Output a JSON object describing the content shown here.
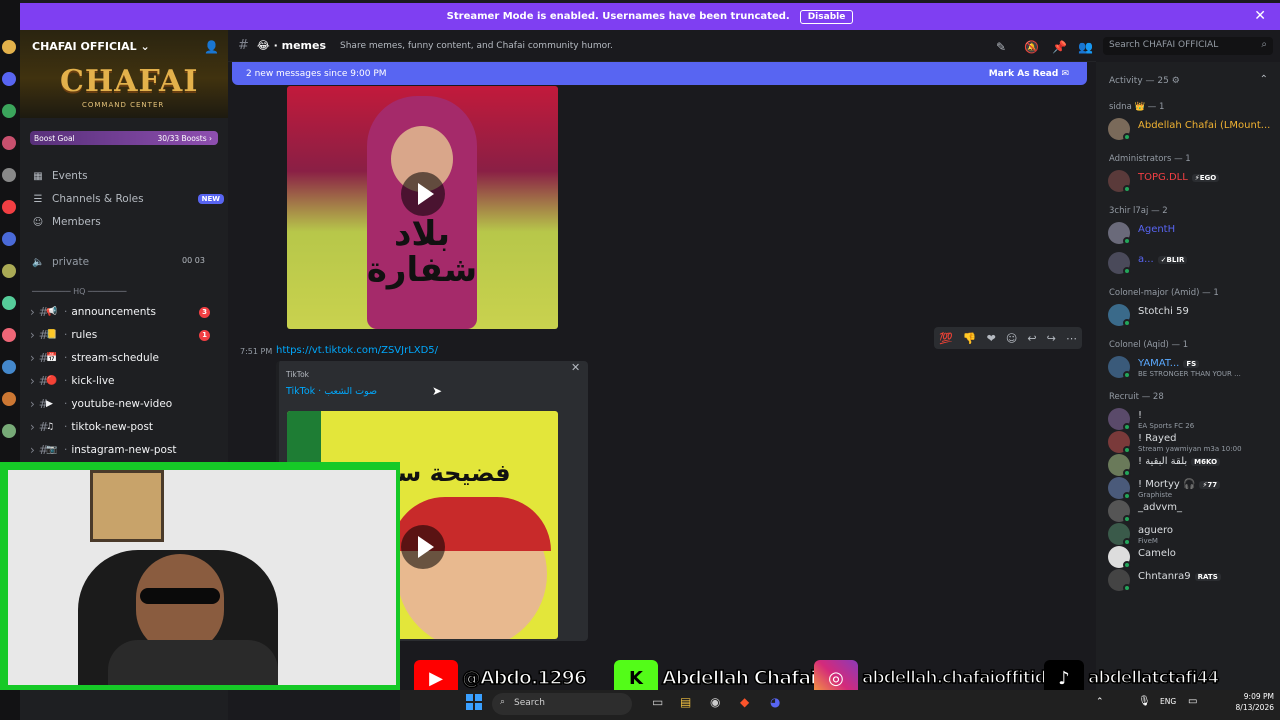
{
  "banner": {
    "text": "Streamer Mode is enabled. Usernames have been truncated.",
    "disable_label": "Disable",
    "close": "✕"
  },
  "server": {
    "name": "CHAFAI OFFICIAL",
    "logo_text": "CHAFAI",
    "logo_subtext": "COMMAND CENTER",
    "boost_label": "Boost Goal",
    "boost_progress": "30/33 Boosts",
    "boost_fraction": 0.909
  },
  "nav": {
    "events": "Events",
    "channels_roles": "Channels & Roles",
    "new_badge": "NEW",
    "members": "Members",
    "private": "private",
    "private_counts": "00 03"
  },
  "category": "HQ",
  "channels": [
    {
      "name": "announcements",
      "emoji": "📢",
      "badge": "3"
    },
    {
      "name": "rules",
      "emoji": "📒",
      "badge": "1"
    },
    {
      "name": "stream-schedule",
      "emoji": "📅",
      "badge": ""
    },
    {
      "name": "kick-live",
      "emoji": "🔴",
      "badge": ""
    },
    {
      "name": "youtube-new-video",
      "emoji": "▶",
      "badge": ""
    },
    {
      "name": "tiktok-new-post",
      "emoji": "♫",
      "badge": ""
    },
    {
      "name": "instagram-new-post",
      "emoji": "📷",
      "badge": ""
    }
  ],
  "header": {
    "channel_name": "memes",
    "topic": "Share memes, funny content, and Chafai community humor.",
    "search_placeholder": "Search CHAFAI OFFICIAL"
  },
  "new_messages": {
    "text": "2 new messages since 9:00 PM",
    "mark_read": "Mark As Read"
  },
  "message": {
    "time": "7:51 PM",
    "link": "https://vt.tiktok.com/ZSVJrLXD5/",
    "embed_provider": "TikTok",
    "embed_title": "TikTok · صوت الشعب",
    "video1_caption": "بلاد شفارة",
    "video2_caption": "فضيحة سي"
  },
  "members_panel": {
    "activity": "Activity — 25",
    "groups": [
      {
        "header": "sidna 👑 — 1",
        "members": [
          {
            "name": "Abdellah Chafai (LMount...",
            "sub": "",
            "tag": "",
            "color": "#f0b232"
          }
        ]
      },
      {
        "header": "Administrators — 1",
        "members": [
          {
            "name": "TOPG.DLL",
            "sub": "",
            "tag": "⚡EGO",
            "color": "#f23f43"
          }
        ]
      },
      {
        "header": "3chir l7aj — 2",
        "members": [
          {
            "name": "AgentH",
            "sub": "",
            "tag": "",
            "color": "#5865f2"
          },
          {
            "name": "a...",
            "sub": "",
            "tag": "✓BLIR",
            "color": "#5865f2"
          }
        ]
      },
      {
        "header": "Colonel-major (Amid) — 1",
        "members": [
          {
            "name": "Stotchi 59",
            "sub": "",
            "tag": "",
            "color": "#dbdee1"
          }
        ]
      },
      {
        "header": "Colonel (Aqid) — 1",
        "members": [
          {
            "name": "YAMAT...",
            "sub": "BE STRONGER THAN YOUR ...",
            "tag": "FS",
            "color": "#5aa9ff"
          }
        ]
      },
      {
        "header": "Recruit — 28",
        "members": [
          {
            "name": "!",
            "sub": "EA Sports FC 26",
            "tag": "",
            "color": "#dbdee1"
          },
          {
            "name": "! Rayed",
            "sub": "Stream yawmiyan m3a 10:00",
            "tag": "",
            "color": "#dbdee1"
          },
          {
            "name": "! بلقة البقية",
            "sub": "",
            "tag": "M6KO",
            "color": "#dbdee1"
          },
          {
            "name": "! Mortyy 🎧",
            "sub": "Graphiste",
            "tag": "⚡77",
            "color": "#dbdee1"
          },
          {
            "name": "_advvm_",
            "sub": "",
            "tag": "",
            "color": "#dbdee1"
          },
          {
            "name": "aguero",
            "sub": "FiveM",
            "tag": "",
            "color": "#dbdee1"
          },
          {
            "name": "Camelo",
            "sub": "",
            "tag": "",
            "color": "#dbdee1"
          },
          {
            "name": "Chntanra9",
            "sub": "",
            "tag": "RATS",
            "color": "#dbdee1"
          }
        ]
      }
    ]
  },
  "overlay": {
    "youtube": "@Abdo.1296",
    "kick": "Abdellah Chafai",
    "instagram": "abdellah.chafaioffitid",
    "tiktok": "abdellatctafi44"
  },
  "taskbar": {
    "search": "Search",
    "lang": "ENG",
    "time": "9:09 PM",
    "date": "8/13/2026"
  },
  "colors": {
    "blurple": "#5865f2",
    "banner": "#7f3ff2",
    "link": "#00a8fc",
    "webcam_border": "#16c927"
  }
}
